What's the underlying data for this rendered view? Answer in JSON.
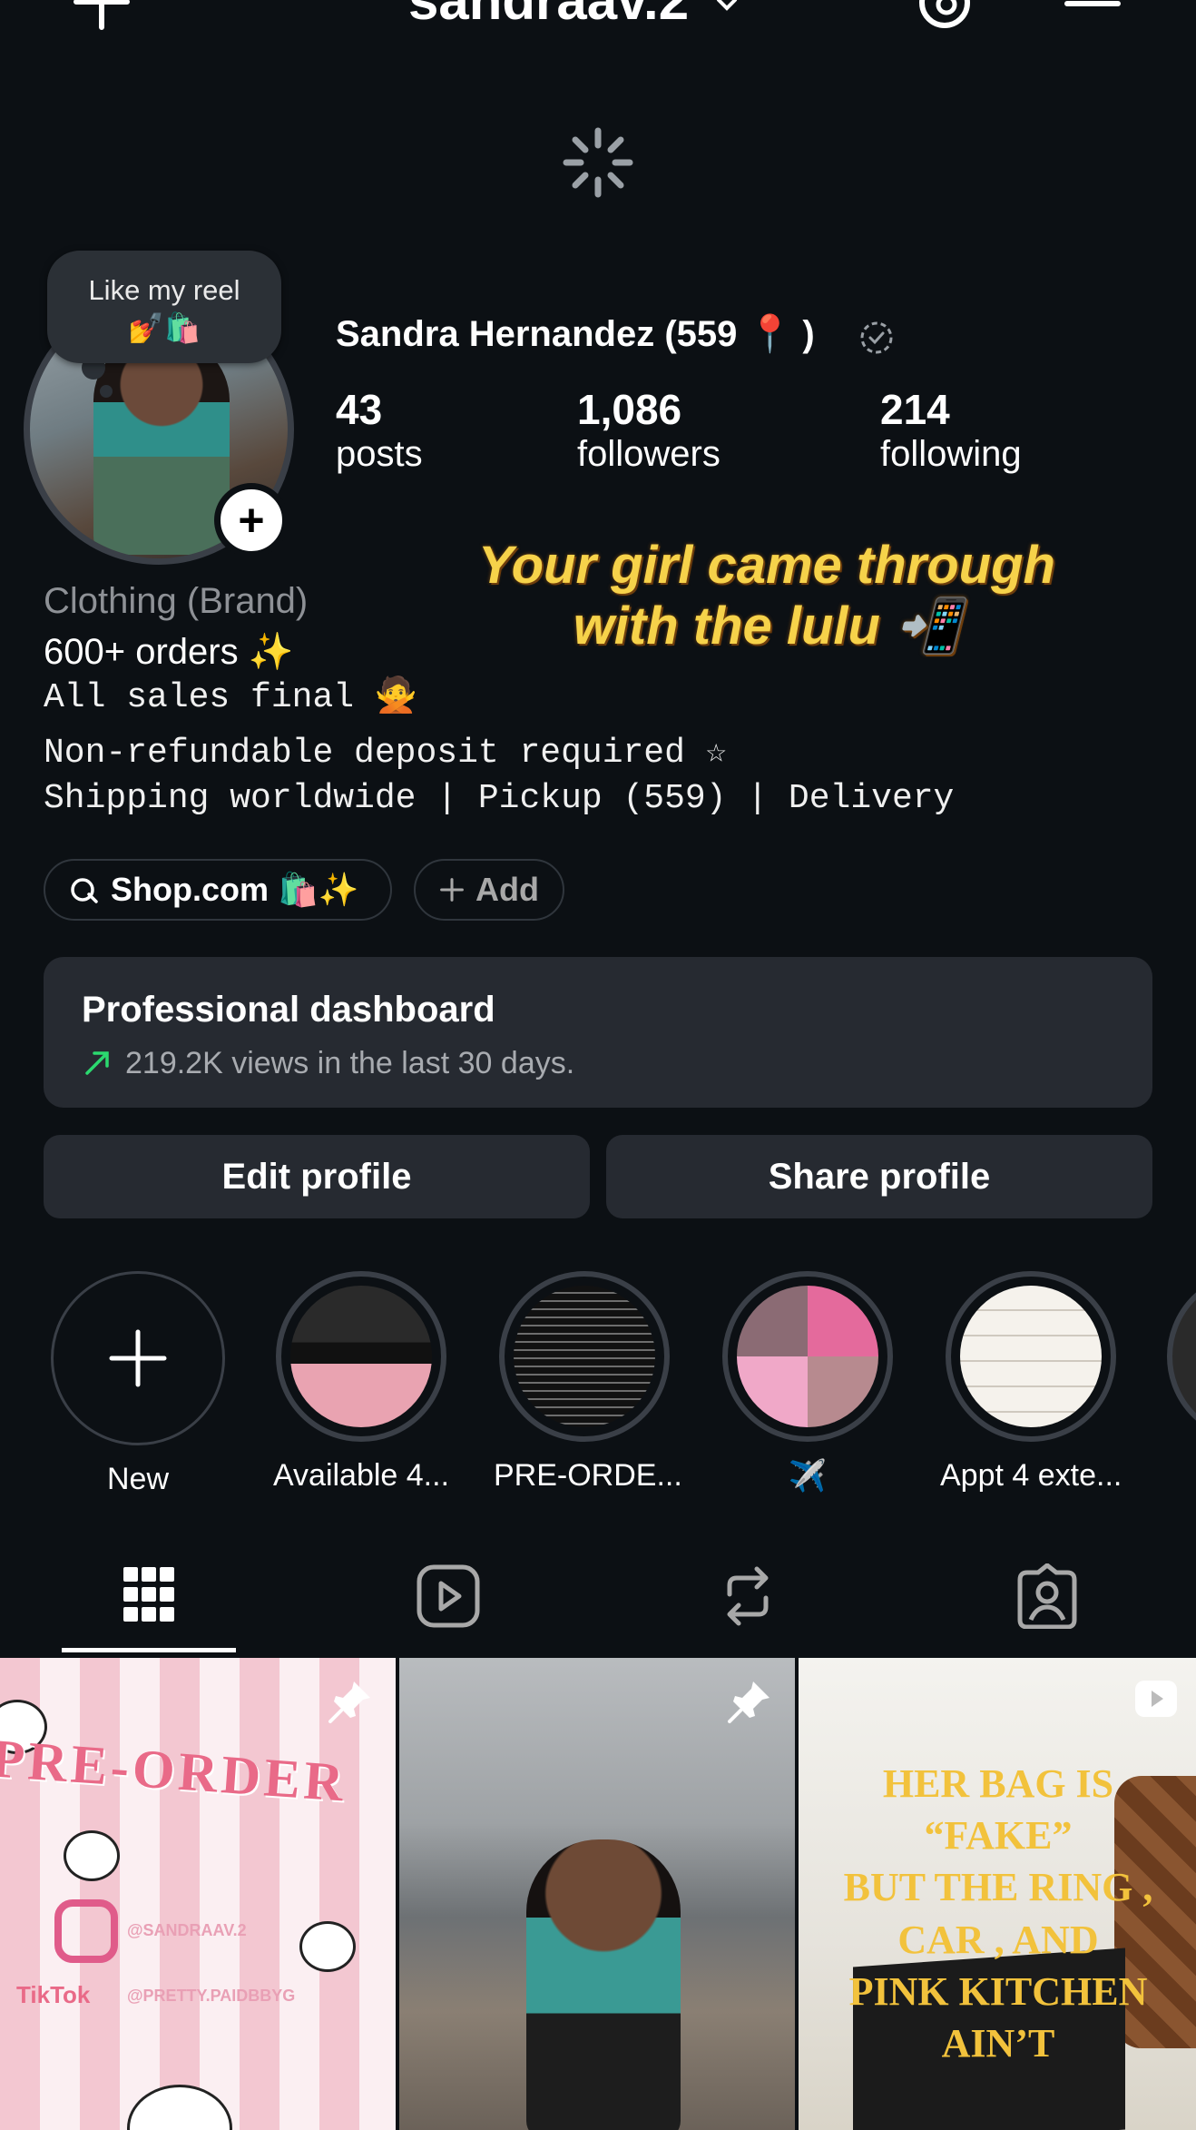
{
  "header": {
    "username": "sandraav.2"
  },
  "profile": {
    "note_text": "Like my reel",
    "note_emoji": "💅🛍️",
    "full_name": "Sandra Hernandez (559 📍 )",
    "stats": [
      {
        "value": "43",
        "label": "posts"
      },
      {
        "value": "1,086",
        "label": "followers"
      },
      {
        "value": "214",
        "label": "following"
      }
    ],
    "category": "Clothing (Brand)",
    "bio_lines": [
      "600+ orders ✨",
      "All sales final 🙅",
      "Non-refundable deposit required ☆",
      "Shipping worldwide | Pickup (559) | Delivery"
    ],
    "overlay_text": "Your girl came through with the lulu 📲"
  },
  "links": {
    "shop_label": "Shop.com 🛍️✨",
    "add_label": "Add"
  },
  "dashboard": {
    "title": "Professional dashboard",
    "subtitle": "219.2K views in the last 30 days."
  },
  "actions": {
    "edit_label": "Edit profile",
    "share_label": "Share profile"
  },
  "highlights": [
    {
      "label": "New"
    },
    {
      "label": "Available 4..."
    },
    {
      "label": "PRE-ORDE..."
    },
    {
      "label": "✈️"
    },
    {
      "label": "Appt 4 exte..."
    }
  ],
  "tabs": [
    "grid",
    "reels",
    "reposts",
    "tagged"
  ],
  "posts": {
    "p1_title": "PRE-ORDER",
    "p1_ig": "@SANDRAAV.2",
    "p1_tiktok_brand": "TikTok",
    "p1_tt": "@PRETTY.PAIDBBYG",
    "p3_line1": "HER BAG IS",
    "p3_line2": "“FAKE”",
    "p3_line3": "BUT THE RING ,",
    "p3_line4": "CAR , AND",
    "p3_line5": "PINK KITCHEN",
    "p3_line6": "AIN’T"
  },
  "colors": {
    "background": "#0c1014",
    "card": "#262a31",
    "accent_green": "#2bd96f",
    "overlay_yellow": "#f6d24a"
  }
}
